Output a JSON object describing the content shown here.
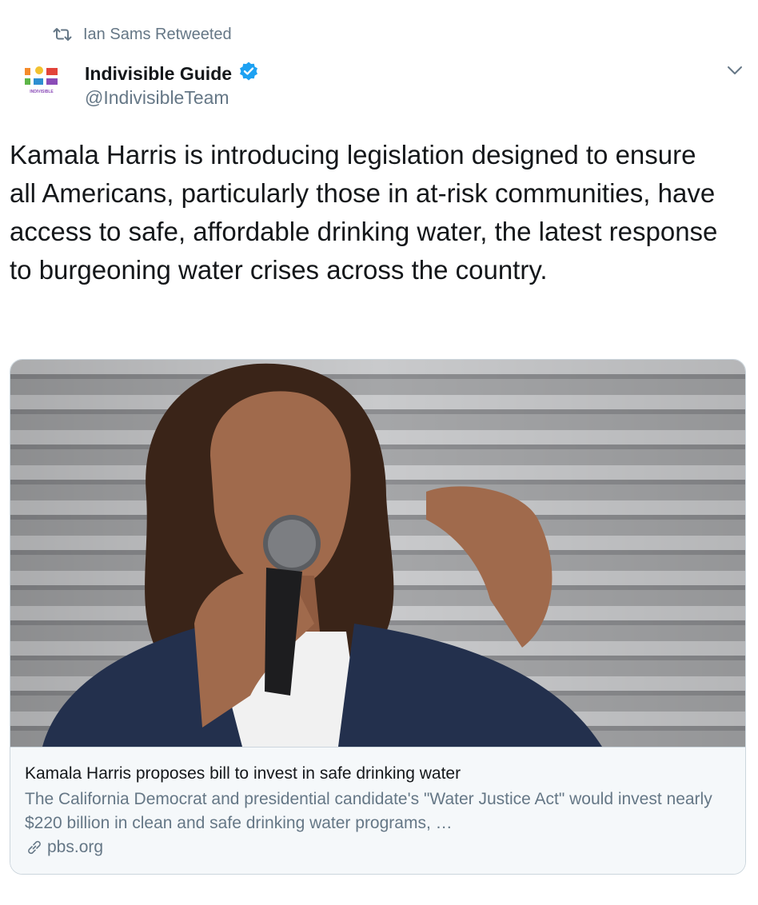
{
  "retweet": {
    "icon": "retweet-icon",
    "text": "Ian Sams Retweeted"
  },
  "author": {
    "avatar_label": "INDIVISIBLE",
    "display_name": "Indivisible Guide",
    "handle": "@IndivisibleTeam",
    "verified_icon": "verified-badge-icon"
  },
  "menu": {
    "icon": "chevron-down-icon"
  },
  "tweet": {
    "text": "Kamala Harris is introducing legislation designed to ensure all Americans, particularly those in at-risk communities, have access to safe, affordable drinking water, the latest response to burgeoning water crises across the country."
  },
  "card": {
    "image_icon": "article-photo",
    "title": "Kamala Harris proposes bill to invest in safe drinking water",
    "description": "The California Democrat and presidential candidate's \"Water Justice Act\" would invest nearly $220 billion in clean and safe drinking water programs, …",
    "domain": "pbs.org",
    "link_icon": "link-icon"
  },
  "colors": {
    "text_primary": "#14171a",
    "text_secondary": "#657786",
    "verified_blue": "#1da1f2",
    "card_border": "#ccd6dd",
    "card_bg": "#f5f8fa"
  }
}
